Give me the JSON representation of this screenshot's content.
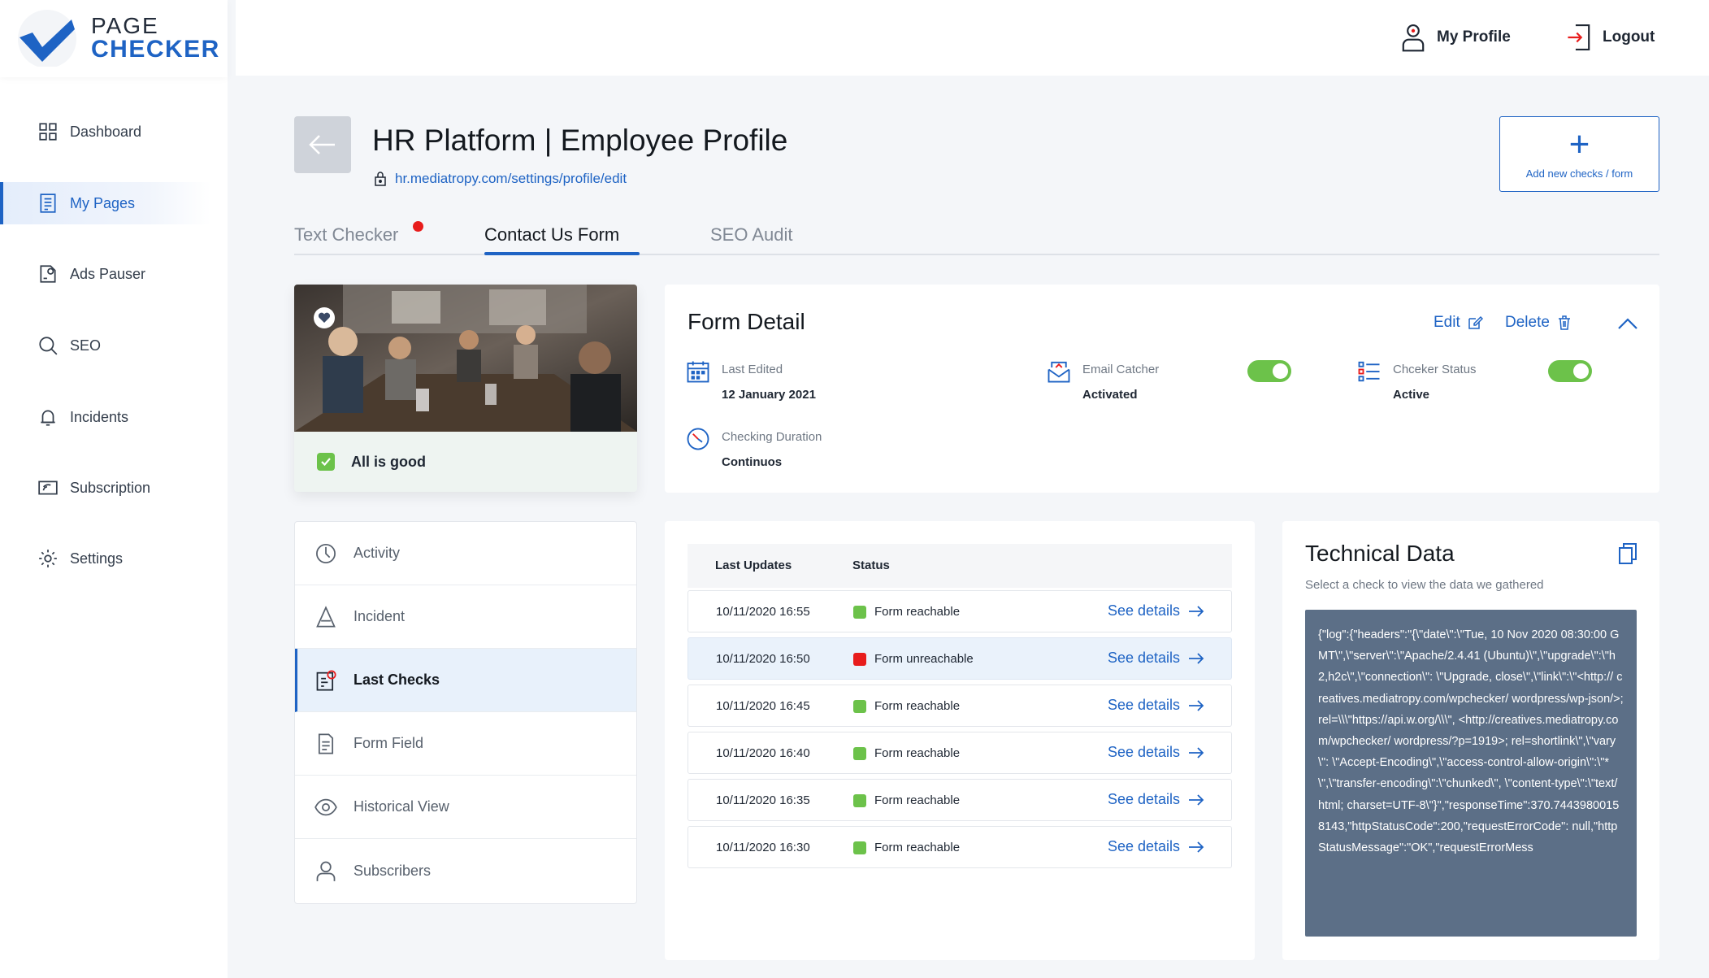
{
  "app": {
    "logo_line1": "PAGE",
    "logo_line2": "CHECKER",
    "brand_color": "#1e63c4"
  },
  "sidebar": {
    "items": [
      {
        "label": "Dashboard",
        "icon": "grid-icon"
      },
      {
        "label": "My Pages",
        "icon": "pages-icon",
        "active": true
      },
      {
        "label": "Ads Pauser",
        "icon": "ads-pauser-icon"
      },
      {
        "label": "SEO",
        "icon": "search-icon"
      },
      {
        "label": "Incidents",
        "icon": "bell-icon"
      },
      {
        "label": "Subscription",
        "icon": "subscription-icon"
      },
      {
        "label": "Settings",
        "icon": "gear-icon"
      }
    ]
  },
  "topbar": {
    "profile_label": "My Profile",
    "logout_label": "Logout"
  },
  "header": {
    "title": "HR Platform | Employee Profile",
    "url": "hr.mediatropy.com/settings/profile/edit",
    "add_button_label": "Add new checks / form"
  },
  "tabs": [
    {
      "label": "Text Checker",
      "has_alert": true
    },
    {
      "label": "Contact Us Form",
      "active": true
    },
    {
      "label": "SEO Audit"
    }
  ],
  "photo_card": {
    "status_label": "All is good"
  },
  "side_menu": {
    "items": [
      {
        "label": "Activity",
        "icon": "activity-icon"
      },
      {
        "label": "Incident",
        "icon": "warning-icon"
      },
      {
        "label": "Last Checks",
        "icon": "checklist-icon",
        "active": true
      },
      {
        "label": "Form Field",
        "icon": "document-icon"
      },
      {
        "label": "Historical View",
        "icon": "eye-icon"
      },
      {
        "label": "Subscribers",
        "icon": "user-icon"
      }
    ]
  },
  "form_detail": {
    "title": "Form Detail",
    "edit_label": "Edit",
    "delete_label": "Delete",
    "fields": {
      "last_edited": {
        "label": "Last Edited",
        "value": "12 January 2021"
      },
      "email_catcher": {
        "label": "Email Catcher",
        "value": "Activated",
        "toggle_on": true
      },
      "checker_status": {
        "label": "Chceker Status",
        "value": "Active",
        "toggle_on": true
      },
      "checking_duration": {
        "label": "Checking Duration",
        "value": "Continuos"
      }
    }
  },
  "last_checks": {
    "headers": [
      "Last Updates",
      "Status"
    ],
    "see_details_label": "See details",
    "status_colors": {
      "ok": "#6cc24a",
      "error": "#e81c1c"
    },
    "rows": [
      {
        "time": "10/11/2020 16:55",
        "status": "Form reachable",
        "state": "ok"
      },
      {
        "time": "10/11/2020 16:50",
        "status": "Form unreachable",
        "state": "error"
      },
      {
        "time": "10/11/2020 16:45",
        "status": "Form reachable",
        "state": "ok"
      },
      {
        "time": "10/11/2020 16:40",
        "status": "Form reachable",
        "state": "ok"
      },
      {
        "time": "10/11/2020 16:35",
        "status": "Form reachable",
        "state": "ok"
      },
      {
        "time": "10/11/2020 16:30",
        "status": "Form reachable",
        "state": "ok"
      }
    ]
  },
  "technical_data": {
    "title": "Technical Data",
    "subtitle": "Select a check to view the data we gathered",
    "payload": "{\"log\":{\"headers\":\"{\\\"date\\\":\\\"Tue, 10 Nov 2020 08:30:00 GMT\\\",\\\"server\\\":\\\"Apache/2.4.41 (Ubuntu)\\\",\\\"upgrade\\\":\\\"h2,h2c\\\",\\\"connection\\\": \\\"Upgrade, close\\\",\\\"link\\\":\\\"<http:// creatives.mediatropy.com/wpchecker/ wordpress/wp-json/>; rel=\\\\\\\"https://api.w.org/\\\\\\\", <http://creatives.mediatropy.com/wpchecker/ wordpress/?p=1919>; rel=shortlink\\\",\\\"vary\\\": \\\"Accept-Encoding\\\",\\\"access-control-allow-origin\\\":\\\"*\\\",\\\"transfer-encoding\\\":\\\"chunked\\\", \\\"content-type\\\":\\\"text/html; charset=UTF-8\\\"}\",\"responseTime\":370.74439800158143,\"httpStatusCode\":200,\"requestErrorCode\": null,\"httpStatusMessage\":\"OK\",\"requestErrorMess"
  }
}
